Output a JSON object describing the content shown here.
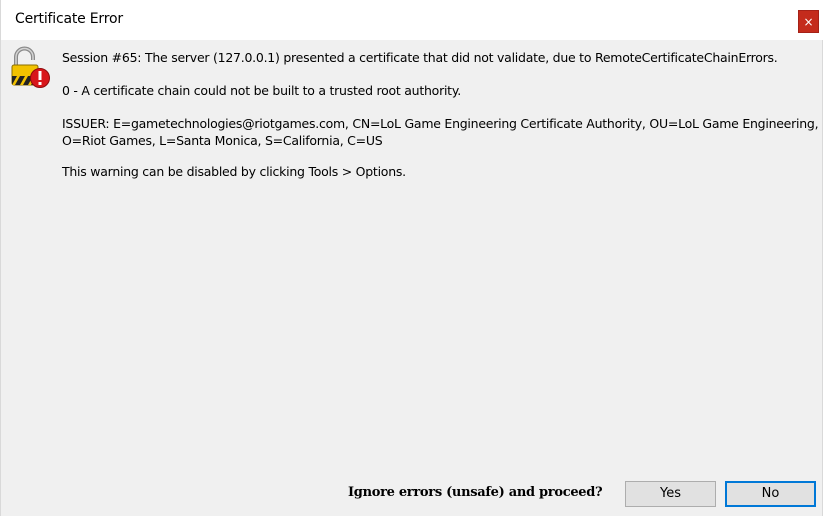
{
  "window": {
    "title": "Certificate Error",
    "close_label": "×"
  },
  "icons": {
    "warning": "lock-warning-icon",
    "close": "close-icon"
  },
  "message": {
    "line1": "Session #65: The server (127.0.0.1) presented a certificate that did not validate, due to RemoteCertificateChainErrors.",
    "line2": "0 - A certificate chain could not be built to a trusted root authority.",
    "issuer_line1": "ISSUER: E=gametechnologies@riotgames.com, CN=LoL Game Engineering Certificate Authority, OU=LoL Game Engineering,",
    "issuer_line2": "O=Riot Games, L=Santa Monica, S=California, C=US",
    "line4": "This warning can be disabled by clicking Tools > Options."
  },
  "footer": {
    "prompt": "Ignore errors (unsafe) and proceed?",
    "yes_label": "Yes",
    "no_label": "No"
  },
  "colors": {
    "background": "#f0f0f0",
    "close_button": "#c42b1c",
    "focus_border": "#0078d7"
  }
}
